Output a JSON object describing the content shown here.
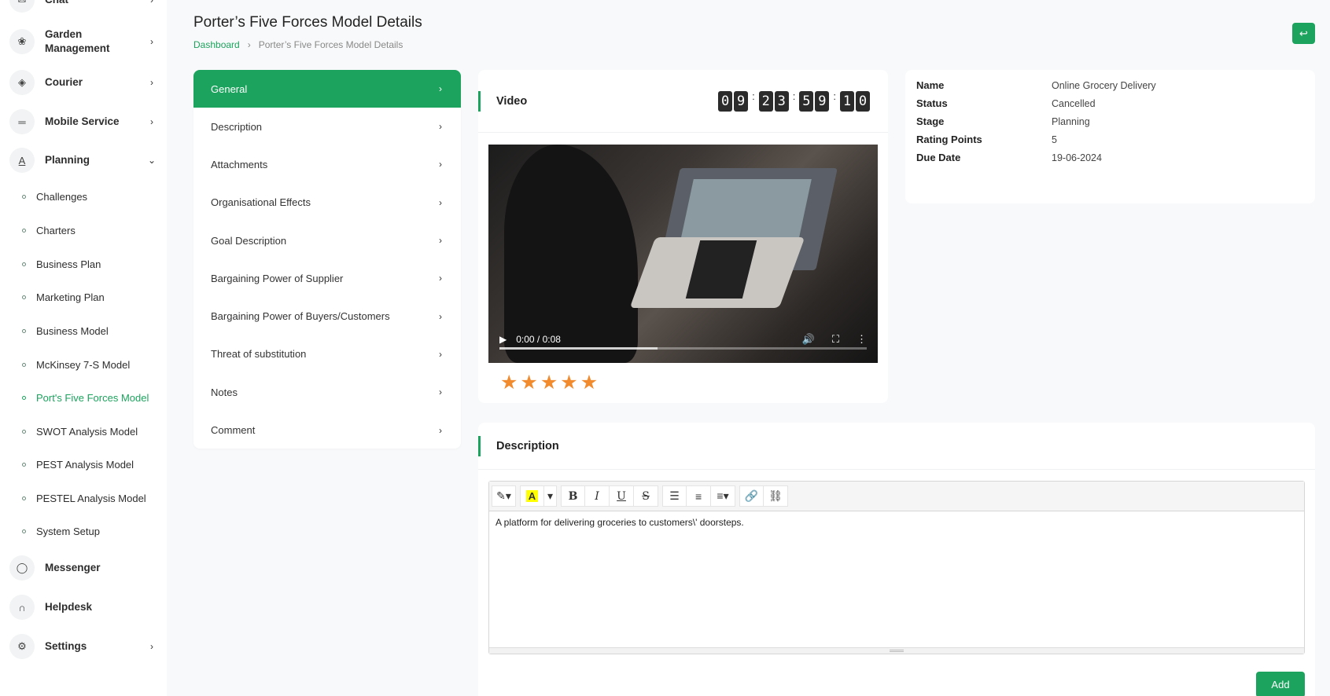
{
  "sidebar": {
    "top_partial": "Chat",
    "items": [
      {
        "label": "Garden Management",
        "icon": "garden-icon"
      },
      {
        "label": "Courier",
        "icon": "box-icon"
      },
      {
        "label": "Mobile Service",
        "icon": "equals-icon"
      },
      {
        "label": "Planning",
        "icon": "planning-icon"
      }
    ],
    "planning_sub": [
      "Challenges",
      "Charters",
      "Business Plan",
      "Marketing Plan",
      "Business Model",
      "McKinsey 7-S Model",
      "Port's Five Forces Model",
      "SWOT Analysis Model",
      "PEST Analysis Model",
      "PESTEL Analysis Model",
      "System Setup"
    ],
    "bottom_items": [
      {
        "label": "Messenger",
        "icon": "chat-icon"
      },
      {
        "label": "Helpdesk",
        "icon": "headset-icon"
      },
      {
        "label": "Settings",
        "icon": "gear-icon"
      }
    ]
  },
  "header": {
    "title": "Porter’s Five Forces Model Details",
    "breadcrumb_home": "Dashboard",
    "breadcrumb_sep": "›",
    "breadcrumb_current": "Porter’s Five Forces Model Details",
    "back_icon": "↩"
  },
  "tabs": [
    "General",
    "Description",
    "Attachments",
    "Organisational Effects",
    "Goal Description",
    "Bargaining Power of Supplier",
    "Bargaining Power of Buyers/Customers",
    "Threat of substitution",
    "Notes",
    "Comment"
  ],
  "video_card": {
    "title": "Video",
    "timer": [
      "0",
      "9",
      "2",
      "3",
      "5",
      "9",
      "1",
      "0"
    ],
    "video_time": "0:00 / 0:08",
    "video_progress": 0.43,
    "rating_stars": 5
  },
  "info": {
    "rows": [
      {
        "key": "Name",
        "value": "Online Grocery Delivery"
      },
      {
        "key": "Status",
        "value": "Cancelled"
      },
      {
        "key": "Stage",
        "value": "Planning"
      },
      {
        "key": "Rating Points",
        "value": "5"
      },
      {
        "key": "Due Date",
        "value": "19-06-2024"
      }
    ]
  },
  "description": {
    "title": "Description",
    "content": "A platform for delivering groceries to customers\\' doorsteps.",
    "add_label": "Add"
  },
  "colors": {
    "accent": "#1ca35d",
    "star": "#f28a2e"
  }
}
